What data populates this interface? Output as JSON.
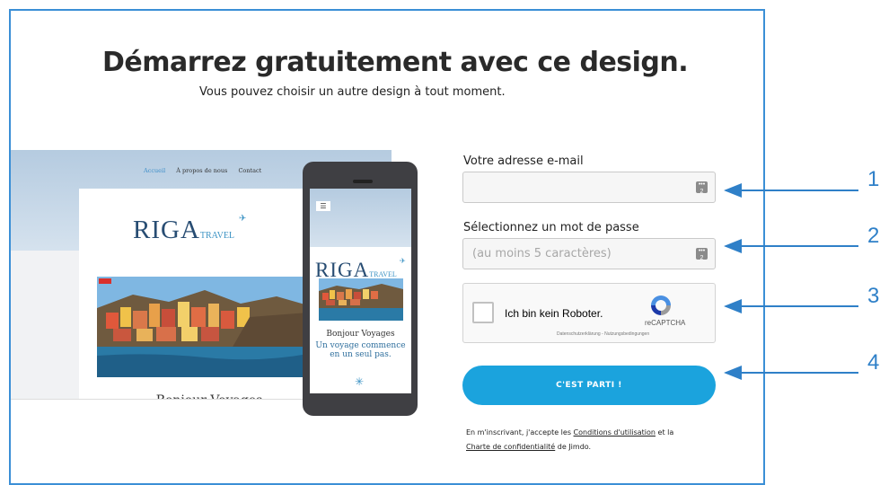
{
  "header": {
    "title": "Démarrez gratuitement avec ce design.",
    "subtitle": "Vous pouvez choisir un autre design à tout moment."
  },
  "preview": {
    "nav": [
      "Accueil",
      "À propos de nous",
      "Contact"
    ],
    "logo_main": "RIGA",
    "logo_sub": "TRAVEL",
    "title": "Bonjour Voyages",
    "tagline": "Un voyage commence en un seul pas."
  },
  "form": {
    "email_label": "Votre adresse e-mail",
    "email_value": "",
    "password_label": "Sélectionnez un mot de passe",
    "password_placeholder": "(au moins 5 caractères)",
    "captcha_text": "Ich bin kein Roboter.",
    "captcha_brand": "reCAPTCHA",
    "captcha_terms": "Datenschutzerklärung - Nutzungsbedingungen",
    "submit_label": "C'EST PARTI !",
    "legal_prefix": "En m'inscrivant, j'accepte les ",
    "legal_terms_link": "Conditions d'utilisation",
    "legal_and": " et la",
    "legal_privacy_link": "Charte de confidentialité",
    "legal_suffix": " de Jimdo."
  },
  "annotations": [
    "1",
    "2",
    "3",
    "4"
  ],
  "colors": {
    "accent": "#1ba3dd",
    "annotation": "#2f80c8",
    "frame": "#3b8fd6"
  }
}
